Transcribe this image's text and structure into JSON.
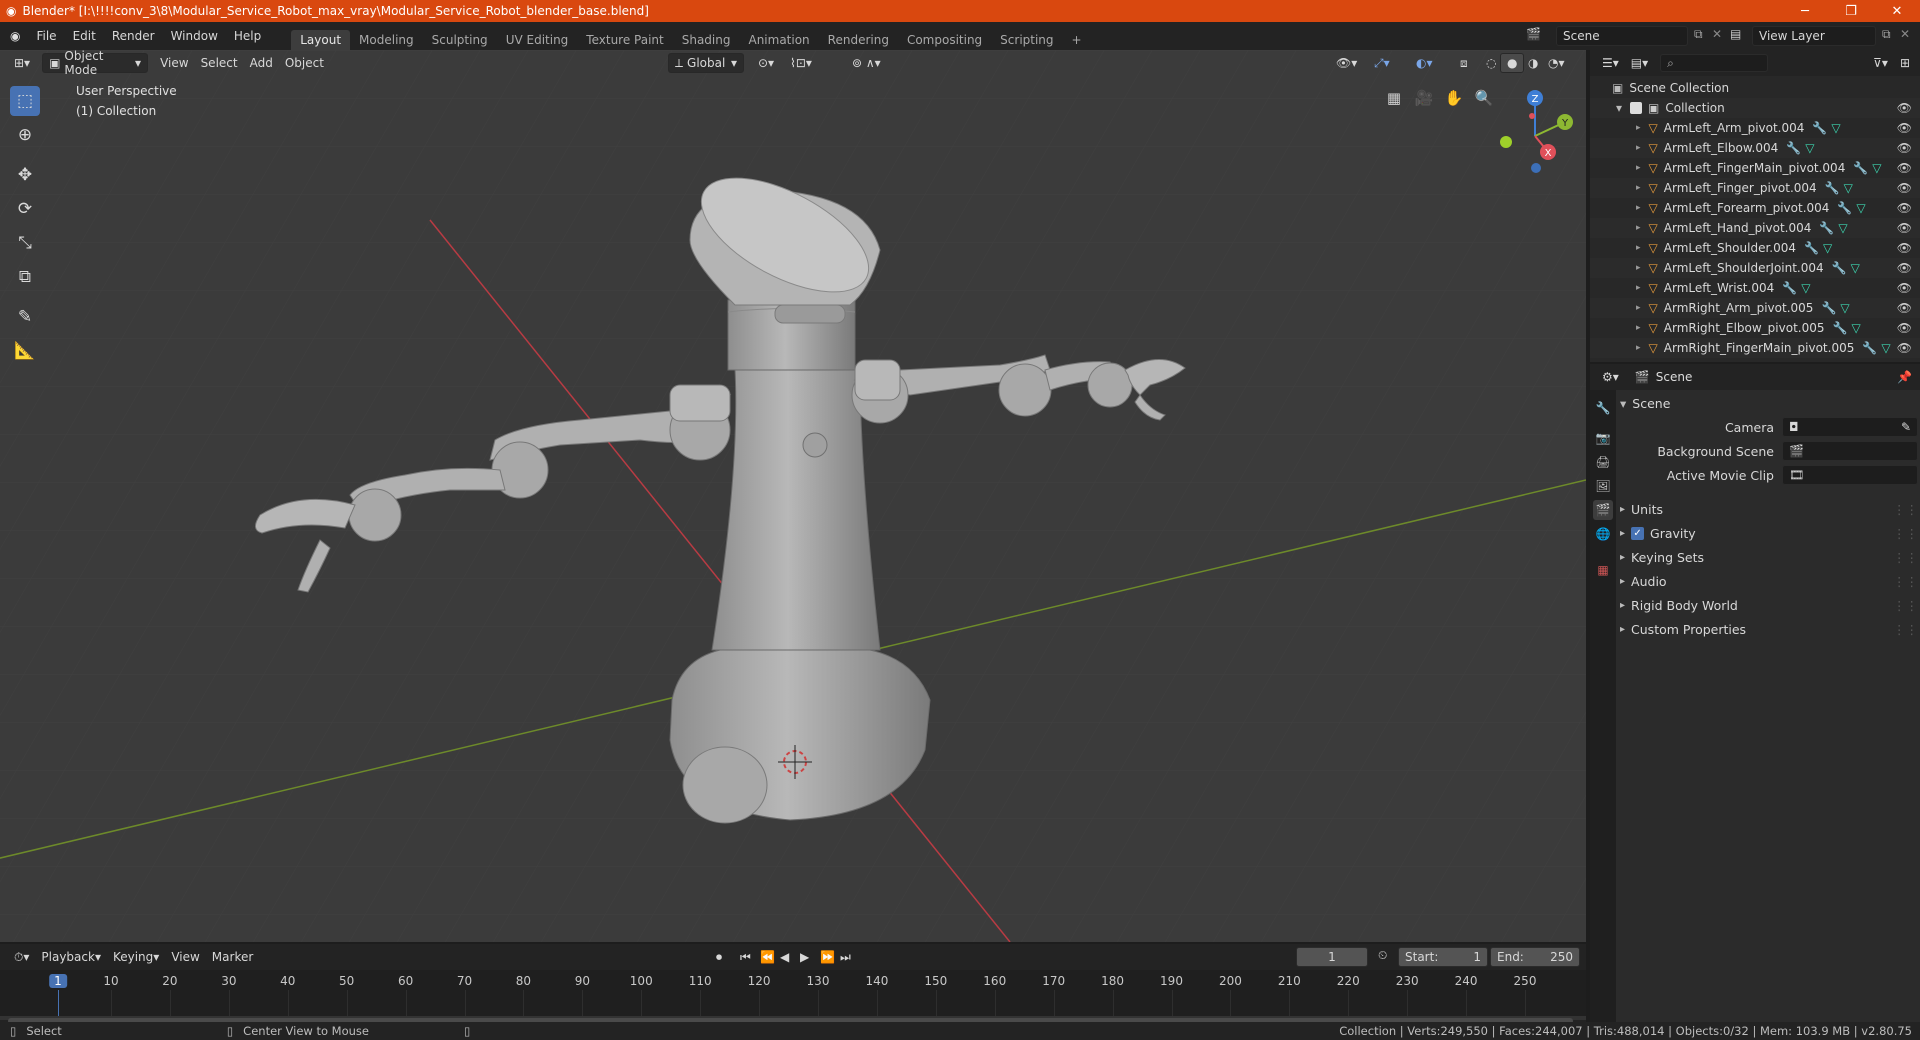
{
  "window": {
    "title": "Blender* [I:\\!!!!conv_3\\8\\Modular_Service_Robot_max_vray\\Modular_Service_Robot_blender_base.blend]"
  },
  "menu": [
    "File",
    "Edit",
    "Render",
    "Window",
    "Help"
  ],
  "workspaces": [
    "Layout",
    "Modeling",
    "Sculpting",
    "UV Editing",
    "Texture Paint",
    "Shading",
    "Animation",
    "Rendering",
    "Compositing",
    "Scripting"
  ],
  "top_right": {
    "scene": "Scene",
    "view_layer": "View Layer"
  },
  "viewport": {
    "mode": "Object Mode",
    "menus": [
      "View",
      "Select",
      "Add",
      "Object"
    ],
    "transform": "Global",
    "overlay_line1": "User Perspective",
    "overlay_line2": "(1) Collection",
    "gizmo": {
      "z": "Z",
      "y": "Y",
      "x": "X"
    }
  },
  "outliner": {
    "root": "Scene Collection",
    "collection": "Collection",
    "items": [
      "ArmLeft_Arm_pivot.004",
      "ArmLeft_Elbow.004",
      "ArmLeft_FingerMain_pivot.004",
      "ArmLeft_Finger_pivot.004",
      "ArmLeft_Forearm_pivot.004",
      "ArmLeft_Hand_pivot.004",
      "ArmLeft_Shoulder.004",
      "ArmLeft_ShoulderJoint.004",
      "ArmLeft_Wrist.004",
      "ArmRight_Arm_pivot.005",
      "ArmRight_Elbow_pivot.005",
      "ArmRight_FingerMain_pivot.005"
    ]
  },
  "properties": {
    "header": "Scene",
    "section": "Scene",
    "camera_label": "Camera",
    "bg_scene_label": "Background Scene",
    "movie_clip_label": "Active Movie Clip",
    "panels": [
      "Units",
      "Gravity",
      "Keying Sets",
      "Audio",
      "Rigid Body World",
      "Custom Properties"
    ]
  },
  "timeline": {
    "menus": [
      "Playback",
      "Keying",
      "View",
      "Marker"
    ],
    "current_frame": "1",
    "start_label": "Start:",
    "start": "1",
    "end_label": "End:",
    "end": "250",
    "ticks": [
      "1",
      "10",
      "20",
      "30",
      "40",
      "50",
      "60",
      "70",
      "80",
      "90",
      "100",
      "110",
      "120",
      "130",
      "140",
      "150",
      "160",
      "170",
      "180",
      "190",
      "200",
      "210",
      "220",
      "230",
      "240",
      "250"
    ]
  },
  "status": {
    "select": "Select",
    "center_view": "Center View to Mouse",
    "stats": "Collection | Verts:249,550 | Faces:244,007 | Tris:488,014 | Objects:0/32 | Mem: 103.9 MB | v2.80.75"
  },
  "colors": {
    "titlebar": "#d9480f",
    "accent": "#4772b3",
    "x_axis": "#b83b43",
    "y_axis": "#6d8a2a"
  }
}
